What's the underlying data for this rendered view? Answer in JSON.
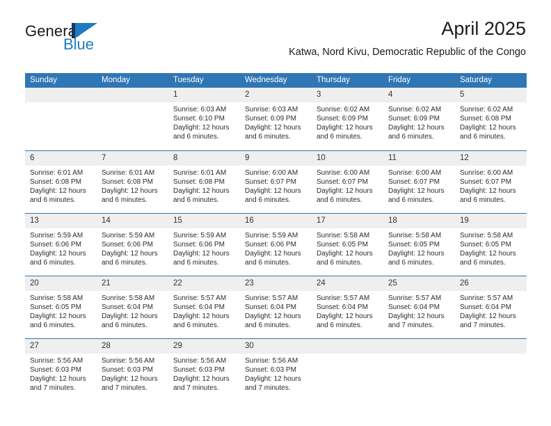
{
  "logo": {
    "text_primary": "General",
    "text_secondary": "Blue",
    "accent_color": "#1f7bc1",
    "dark_color": "#17365d",
    "mark_icon": "triangle-flag-icon"
  },
  "header": {
    "month_title": "April 2025",
    "location": "Katwa, Nord Kivu, Democratic Republic of the Congo"
  },
  "theme": {
    "header_blue": "#2f76b4",
    "daynum_bg": "#efefef",
    "text": "#2b2b2b"
  },
  "weekday_headers": [
    "Sunday",
    "Monday",
    "Tuesday",
    "Wednesday",
    "Thursday",
    "Friday",
    "Saturday"
  ],
  "labels": {
    "sunrise_prefix": "Sunrise:",
    "sunset_prefix": "Sunset:",
    "daylight_prefix": "Daylight:"
  },
  "weeks": [
    [
      {
        "day": "",
        "sunrise": "",
        "sunset": "",
        "daylight_line1": "",
        "daylight_line2": "",
        "empty": true
      },
      {
        "day": "",
        "sunrise": "",
        "sunset": "",
        "daylight_line1": "",
        "daylight_line2": "",
        "empty": true
      },
      {
        "day": "1",
        "sunrise": "Sunrise: 6:03 AM",
        "sunset": "Sunset: 6:10 PM",
        "daylight_line1": "Daylight: 12 hours",
        "daylight_line2": "and 6 minutes."
      },
      {
        "day": "2",
        "sunrise": "Sunrise: 6:03 AM",
        "sunset": "Sunset: 6:09 PM",
        "daylight_line1": "Daylight: 12 hours",
        "daylight_line2": "and 6 minutes."
      },
      {
        "day": "3",
        "sunrise": "Sunrise: 6:02 AM",
        "sunset": "Sunset: 6:09 PM",
        "daylight_line1": "Daylight: 12 hours",
        "daylight_line2": "and 6 minutes."
      },
      {
        "day": "4",
        "sunrise": "Sunrise: 6:02 AM",
        "sunset": "Sunset: 6:09 PM",
        "daylight_line1": "Daylight: 12 hours",
        "daylight_line2": "and 6 minutes."
      },
      {
        "day": "5",
        "sunrise": "Sunrise: 6:02 AM",
        "sunset": "Sunset: 6:08 PM",
        "daylight_line1": "Daylight: 12 hours",
        "daylight_line2": "and 6 minutes."
      }
    ],
    [
      {
        "day": "6",
        "sunrise": "Sunrise: 6:01 AM",
        "sunset": "Sunset: 6:08 PM",
        "daylight_line1": "Daylight: 12 hours",
        "daylight_line2": "and 6 minutes."
      },
      {
        "day": "7",
        "sunrise": "Sunrise: 6:01 AM",
        "sunset": "Sunset: 6:08 PM",
        "daylight_line1": "Daylight: 12 hours",
        "daylight_line2": "and 6 minutes."
      },
      {
        "day": "8",
        "sunrise": "Sunrise: 6:01 AM",
        "sunset": "Sunset: 6:08 PM",
        "daylight_line1": "Daylight: 12 hours",
        "daylight_line2": "and 6 minutes."
      },
      {
        "day": "9",
        "sunrise": "Sunrise: 6:00 AM",
        "sunset": "Sunset: 6:07 PM",
        "daylight_line1": "Daylight: 12 hours",
        "daylight_line2": "and 6 minutes."
      },
      {
        "day": "10",
        "sunrise": "Sunrise: 6:00 AM",
        "sunset": "Sunset: 6:07 PM",
        "daylight_line1": "Daylight: 12 hours",
        "daylight_line2": "and 6 minutes."
      },
      {
        "day": "11",
        "sunrise": "Sunrise: 6:00 AM",
        "sunset": "Sunset: 6:07 PM",
        "daylight_line1": "Daylight: 12 hours",
        "daylight_line2": "and 6 minutes."
      },
      {
        "day": "12",
        "sunrise": "Sunrise: 6:00 AM",
        "sunset": "Sunset: 6:07 PM",
        "daylight_line1": "Daylight: 12 hours",
        "daylight_line2": "and 6 minutes."
      }
    ],
    [
      {
        "day": "13",
        "sunrise": "Sunrise: 5:59 AM",
        "sunset": "Sunset: 6:06 PM",
        "daylight_line1": "Daylight: 12 hours",
        "daylight_line2": "and 6 minutes."
      },
      {
        "day": "14",
        "sunrise": "Sunrise: 5:59 AM",
        "sunset": "Sunset: 6:06 PM",
        "daylight_line1": "Daylight: 12 hours",
        "daylight_line2": "and 6 minutes."
      },
      {
        "day": "15",
        "sunrise": "Sunrise: 5:59 AM",
        "sunset": "Sunset: 6:06 PM",
        "daylight_line1": "Daylight: 12 hours",
        "daylight_line2": "and 6 minutes."
      },
      {
        "day": "16",
        "sunrise": "Sunrise: 5:59 AM",
        "sunset": "Sunset: 6:06 PM",
        "daylight_line1": "Daylight: 12 hours",
        "daylight_line2": "and 6 minutes."
      },
      {
        "day": "17",
        "sunrise": "Sunrise: 5:58 AM",
        "sunset": "Sunset: 6:05 PM",
        "daylight_line1": "Daylight: 12 hours",
        "daylight_line2": "and 6 minutes."
      },
      {
        "day": "18",
        "sunrise": "Sunrise: 5:58 AM",
        "sunset": "Sunset: 6:05 PM",
        "daylight_line1": "Daylight: 12 hours",
        "daylight_line2": "and 6 minutes."
      },
      {
        "day": "19",
        "sunrise": "Sunrise: 5:58 AM",
        "sunset": "Sunset: 6:05 PM",
        "daylight_line1": "Daylight: 12 hours",
        "daylight_line2": "and 6 minutes."
      }
    ],
    [
      {
        "day": "20",
        "sunrise": "Sunrise: 5:58 AM",
        "sunset": "Sunset: 6:05 PM",
        "daylight_line1": "Daylight: 12 hours",
        "daylight_line2": "and 6 minutes."
      },
      {
        "day": "21",
        "sunrise": "Sunrise: 5:58 AM",
        "sunset": "Sunset: 6:04 PM",
        "daylight_line1": "Daylight: 12 hours",
        "daylight_line2": "and 6 minutes."
      },
      {
        "day": "22",
        "sunrise": "Sunrise: 5:57 AM",
        "sunset": "Sunset: 6:04 PM",
        "daylight_line1": "Daylight: 12 hours",
        "daylight_line2": "and 6 minutes."
      },
      {
        "day": "23",
        "sunrise": "Sunrise: 5:57 AM",
        "sunset": "Sunset: 6:04 PM",
        "daylight_line1": "Daylight: 12 hours",
        "daylight_line2": "and 6 minutes."
      },
      {
        "day": "24",
        "sunrise": "Sunrise: 5:57 AM",
        "sunset": "Sunset: 6:04 PM",
        "daylight_line1": "Daylight: 12 hours",
        "daylight_line2": "and 6 minutes."
      },
      {
        "day": "25",
        "sunrise": "Sunrise: 5:57 AM",
        "sunset": "Sunset: 6:04 PM",
        "daylight_line1": "Daylight: 12 hours",
        "daylight_line2": "and 7 minutes."
      },
      {
        "day": "26",
        "sunrise": "Sunrise: 5:57 AM",
        "sunset": "Sunset: 6:04 PM",
        "daylight_line1": "Daylight: 12 hours",
        "daylight_line2": "and 7 minutes."
      }
    ],
    [
      {
        "day": "27",
        "sunrise": "Sunrise: 5:56 AM",
        "sunset": "Sunset: 6:03 PM",
        "daylight_line1": "Daylight: 12 hours",
        "daylight_line2": "and 7 minutes."
      },
      {
        "day": "28",
        "sunrise": "Sunrise: 5:56 AM",
        "sunset": "Sunset: 6:03 PM",
        "daylight_line1": "Daylight: 12 hours",
        "daylight_line2": "and 7 minutes."
      },
      {
        "day": "29",
        "sunrise": "Sunrise: 5:56 AM",
        "sunset": "Sunset: 6:03 PM",
        "daylight_line1": "Daylight: 12 hours",
        "daylight_line2": "and 7 minutes."
      },
      {
        "day": "30",
        "sunrise": "Sunrise: 5:56 AM",
        "sunset": "Sunset: 6:03 PM",
        "daylight_line1": "Daylight: 12 hours",
        "daylight_line2": "and 7 minutes."
      },
      {
        "day": "",
        "sunrise": "",
        "sunset": "",
        "daylight_line1": "",
        "daylight_line2": "",
        "empty": true
      },
      {
        "day": "",
        "sunrise": "",
        "sunset": "",
        "daylight_line1": "",
        "daylight_line2": "",
        "empty": true
      },
      {
        "day": "",
        "sunrise": "",
        "sunset": "",
        "daylight_line1": "",
        "daylight_line2": "",
        "empty": true
      }
    ]
  ]
}
